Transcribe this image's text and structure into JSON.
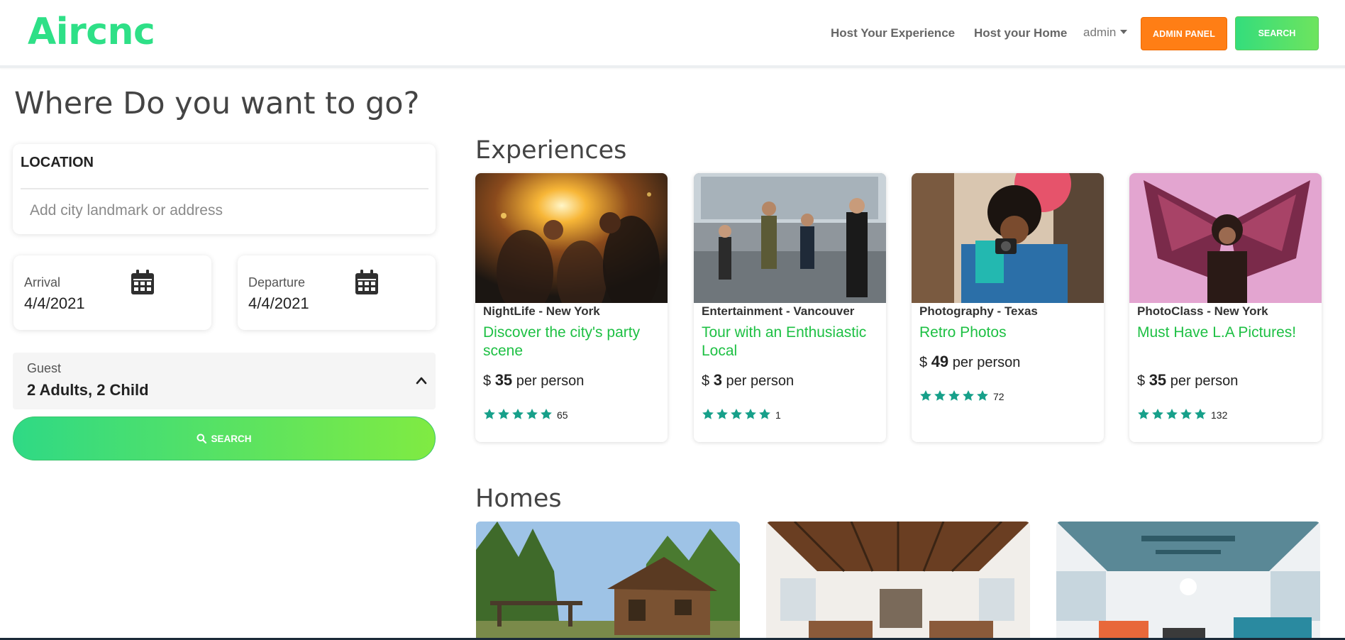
{
  "header": {
    "brand": "Aircnc",
    "nav_host_experience": "Host Your Experience",
    "nav_host_home": "Host your Home",
    "nav_user": "admin",
    "admin_button": "ADMIN PANEL",
    "search_button": "SEARCH"
  },
  "search_panel": {
    "title": "Where Do you want to go?",
    "location_label": "LOCATION",
    "location_placeholder": "Add city landmark or address",
    "location_value": "",
    "arrival_label": "Arrival",
    "arrival_value": "4/4/2021",
    "departure_label": "Departure",
    "departure_value": "4/4/2021",
    "guest_label": "Guest",
    "guest_value": "2 Adults, 2 Child",
    "search_button": "SEARCH"
  },
  "experiences": {
    "title": "Experiences",
    "items": [
      {
        "category": "NightLife - New York",
        "name": "Discover the city's party scene",
        "currency": "$",
        "price": "35",
        "unit": "per person",
        "rating": 5,
        "reviews": "65"
      },
      {
        "category": "Entertainment - Vancouver",
        "name": "Tour with an Enthusiastic Local",
        "currency": "$",
        "price": "3",
        "unit": "per person",
        "rating": 5,
        "reviews": "1"
      },
      {
        "category": "Photography - Texas",
        "name": "Retro Photos",
        "currency": "$",
        "price": "49",
        "unit": "per person",
        "rating": 5,
        "reviews": "72"
      },
      {
        "category": "PhotoClass - New York",
        "name": "Must Have L.A Pictures!",
        "currency": "$",
        "price": "35",
        "unit": "per person",
        "rating": 5,
        "reviews": "132"
      }
    ]
  },
  "homes": {
    "title": "Homes"
  },
  "colors": {
    "brand": "#2ee087",
    "accent_green": "#1ec044",
    "admin_orange": "#ff7e15",
    "star_teal": "#17a08a"
  }
}
